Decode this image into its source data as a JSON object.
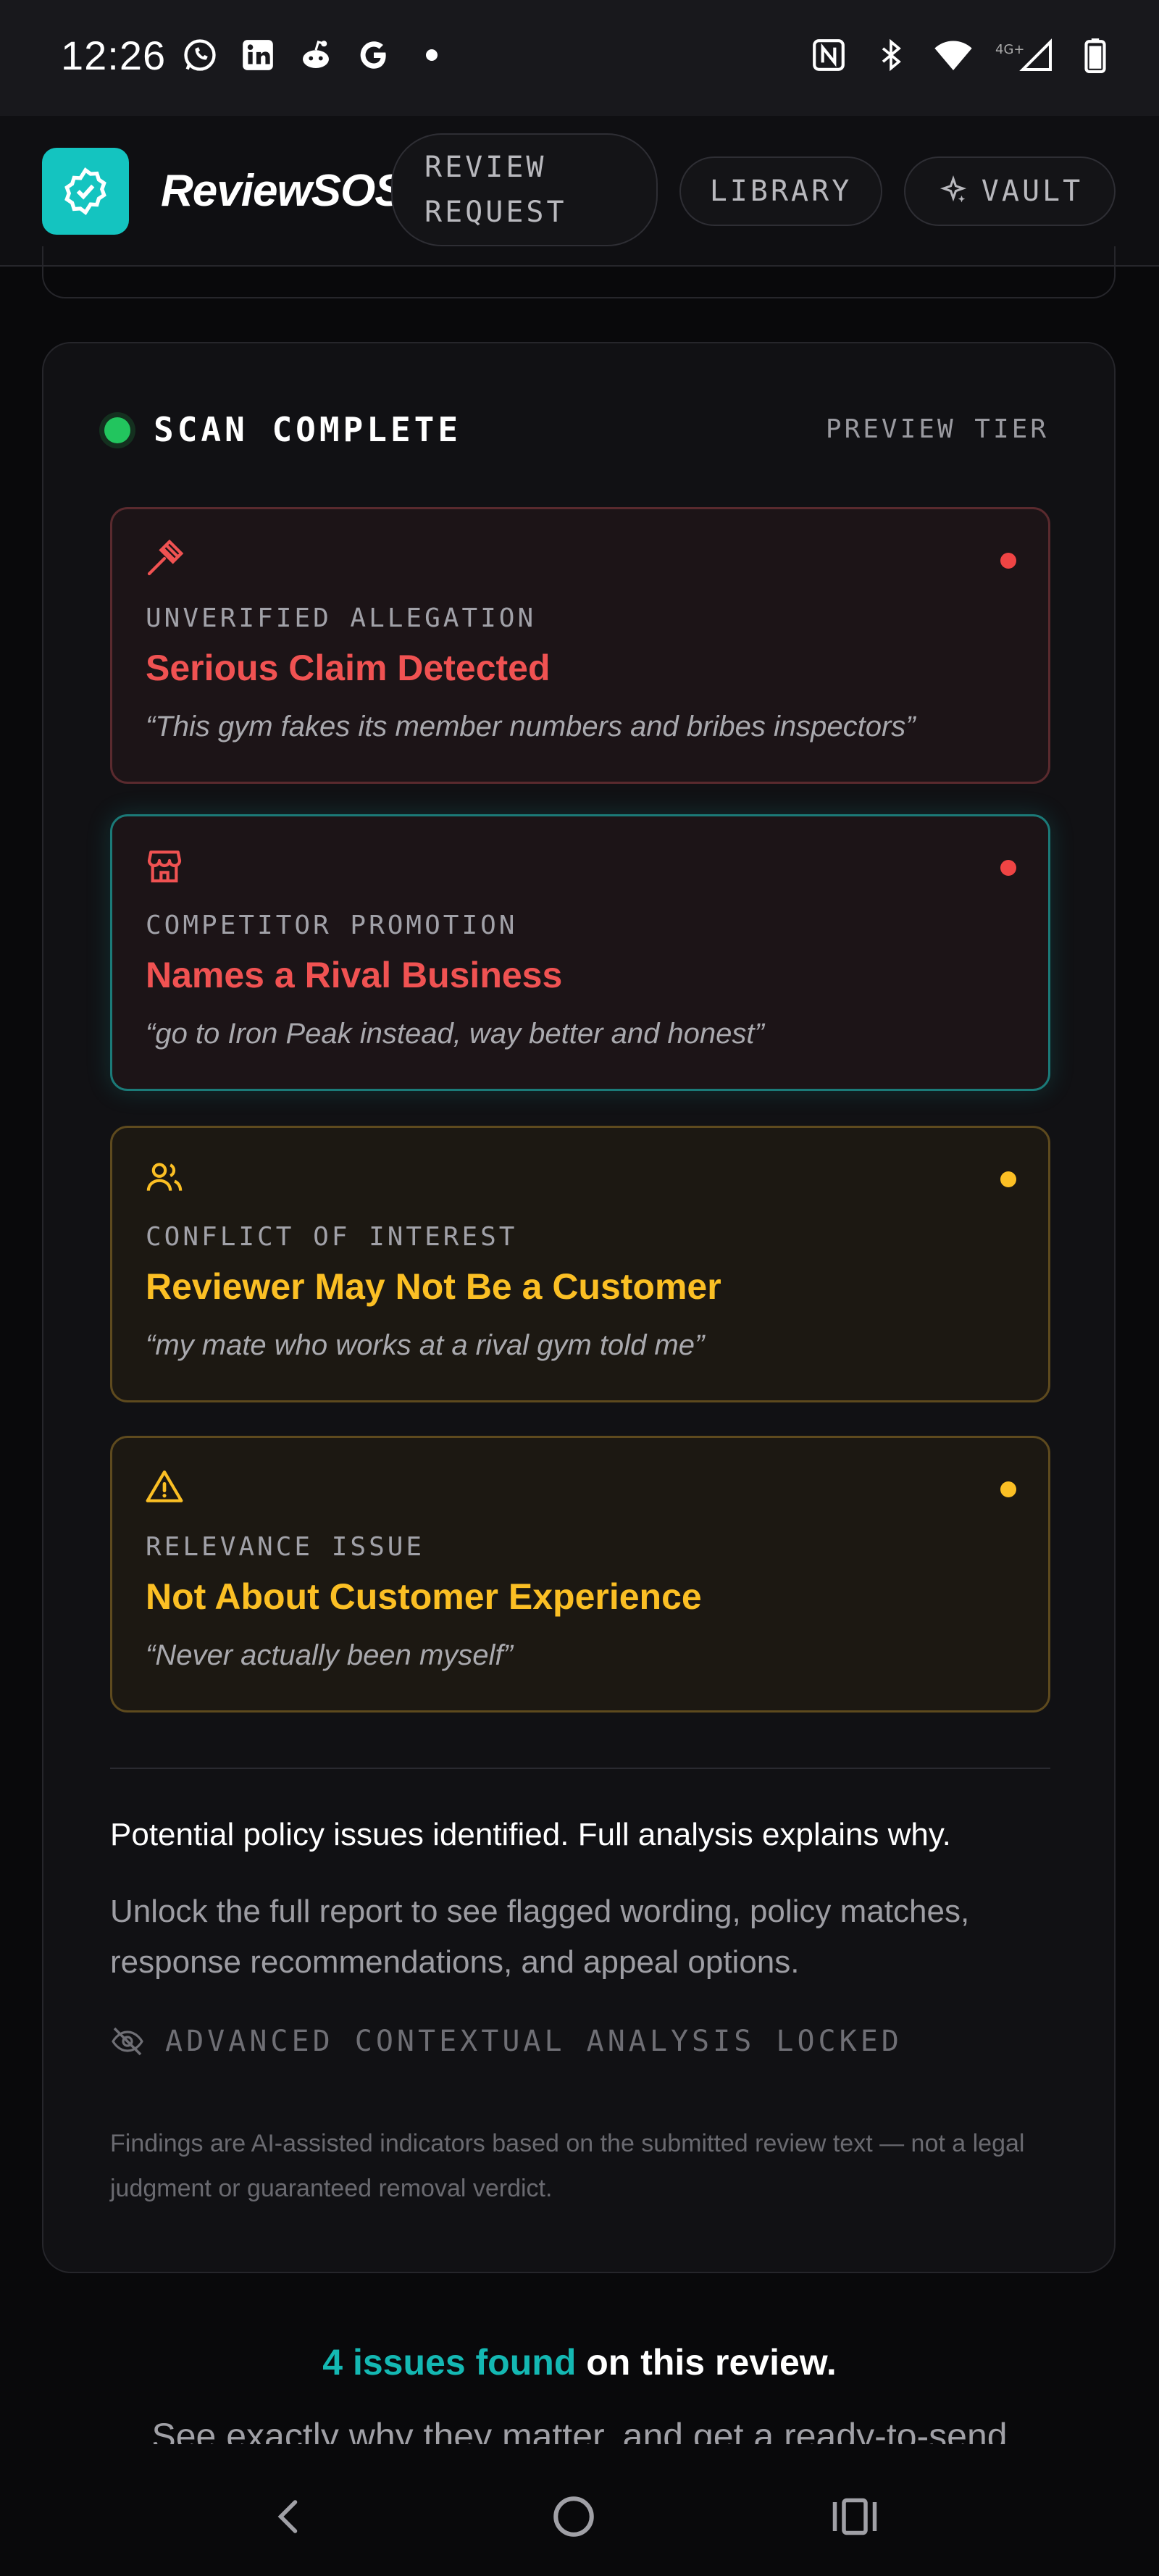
{
  "status_bar": {
    "time": "12:26",
    "left_icons": [
      "whatsapp-icon",
      "linkedin-icon",
      "reddit-icon",
      "google-icon",
      "dot-icon"
    ],
    "right_icons": [
      "nfc-icon",
      "bluetooth-icon",
      "wifi-icon",
      "signal-4g-icon",
      "battery-icon"
    ],
    "network_label": "4G+"
  },
  "header": {
    "brand": "ReviewSOS",
    "nav": {
      "review_request_line1": "REVIEW",
      "review_request_line2": "REQUEST",
      "library": "LIBRARY",
      "vault": "VAULT"
    }
  },
  "scan": {
    "status": "SCAN COMPLETE",
    "tier": "PREVIEW TIER",
    "issues": [
      {
        "icon": "gavel-icon",
        "severity": "red",
        "category": "UNVERIFIED ALLEGATION",
        "title": "Serious Claim Detected",
        "quote": "“This gym fakes its member numbers and bribes inspectors”"
      },
      {
        "icon": "store-icon",
        "severity": "red",
        "category": "COMPETITOR PROMOTION",
        "title": "Names a Rival Business",
        "quote": "“go to Iron Peak instead, way better and honest”"
      },
      {
        "icon": "users-icon",
        "severity": "amber",
        "category": "CONFLICT OF INTEREST",
        "title": "Reviewer May Not Be a Customer",
        "quote": "“my mate who works at a rival gym told me”"
      },
      {
        "icon": "warning-icon",
        "severity": "amber",
        "category": "RELEVANCE ISSUE",
        "title": "Not About Customer Experience",
        "quote": "“Never actually been myself”"
      }
    ],
    "summary": "Potential policy issues identified. Full analysis explains why.",
    "unlock_text": "Unlock the full report to see flagged wording, policy matches, response recommendations, and appeal options.",
    "locked_label": "ADVANCED CONTEXTUAL ANALYSIS LOCKED",
    "disclaimer": "Findings are AI-assisted indicators based on the submitted review text — not a legal judgment or guaranteed removal verdict."
  },
  "footer": {
    "issues_count_text": "4 issues found",
    "issues_suffix": " on this review.",
    "cut_text": "See exactly why they matter, and get a ready-to-send"
  },
  "colors": {
    "accent": "#14c4c0",
    "danger": "#f05252",
    "warning": "#fbbf24",
    "success": "#22c55e"
  }
}
